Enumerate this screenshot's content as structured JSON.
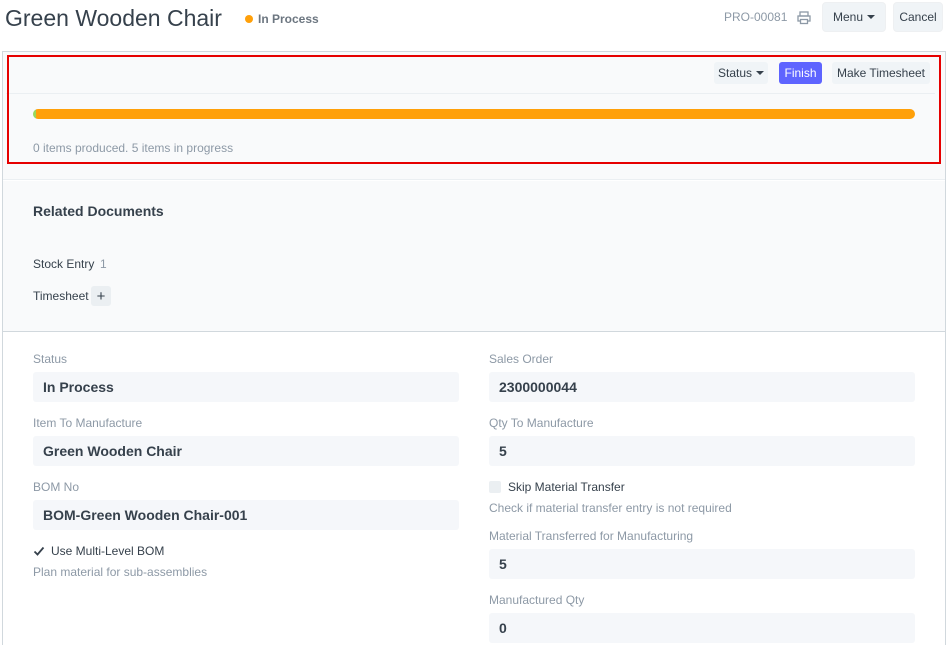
{
  "header": {
    "title": "Green Wooden Chair",
    "status": "In Process",
    "status_color": "#ffa00a",
    "doc_id": "PRO-00081",
    "print_icon": "print-icon",
    "menu_label": "Menu",
    "cancel_label": "Cancel"
  },
  "actions": {
    "status_label": "Status",
    "finish_label": "Finish",
    "timesheet_label": "Make Timesheet"
  },
  "progress": {
    "produced_fraction": 0.003,
    "in_progress_fraction": 0.997,
    "produced_color": "#98d85b",
    "in_progress_color": "#ffa00a",
    "text": "0 items produced. 5 items in progress"
  },
  "related": {
    "title": "Related Documents",
    "stock_entry_label": "Stock Entry",
    "stock_entry_count": "1",
    "timesheet_label": "Timesheet",
    "add_icon": "+"
  },
  "form": {
    "status_label": "Status",
    "status_value": "In Process",
    "item_label": "Item To Manufacture",
    "item_value": "Green Wooden Chair",
    "bom_label": "BOM No",
    "bom_value": "BOM-Green Wooden Chair-001",
    "multi_level_label": "Use Multi-Level BOM",
    "multi_level_help": "Plan material for sub-assemblies",
    "sales_order_label": "Sales Order",
    "sales_order_value": "2300000044",
    "qty_label": "Qty To Manufacture",
    "qty_value": "5",
    "skip_transfer_label": "Skip Material Transfer",
    "skip_transfer_help": "Check if material transfer entry is not required",
    "transferred_label": "Material Transferred for Manufacturing",
    "transferred_value": "5",
    "manufactured_label": "Manufactured Qty",
    "manufactured_value": "0"
  }
}
